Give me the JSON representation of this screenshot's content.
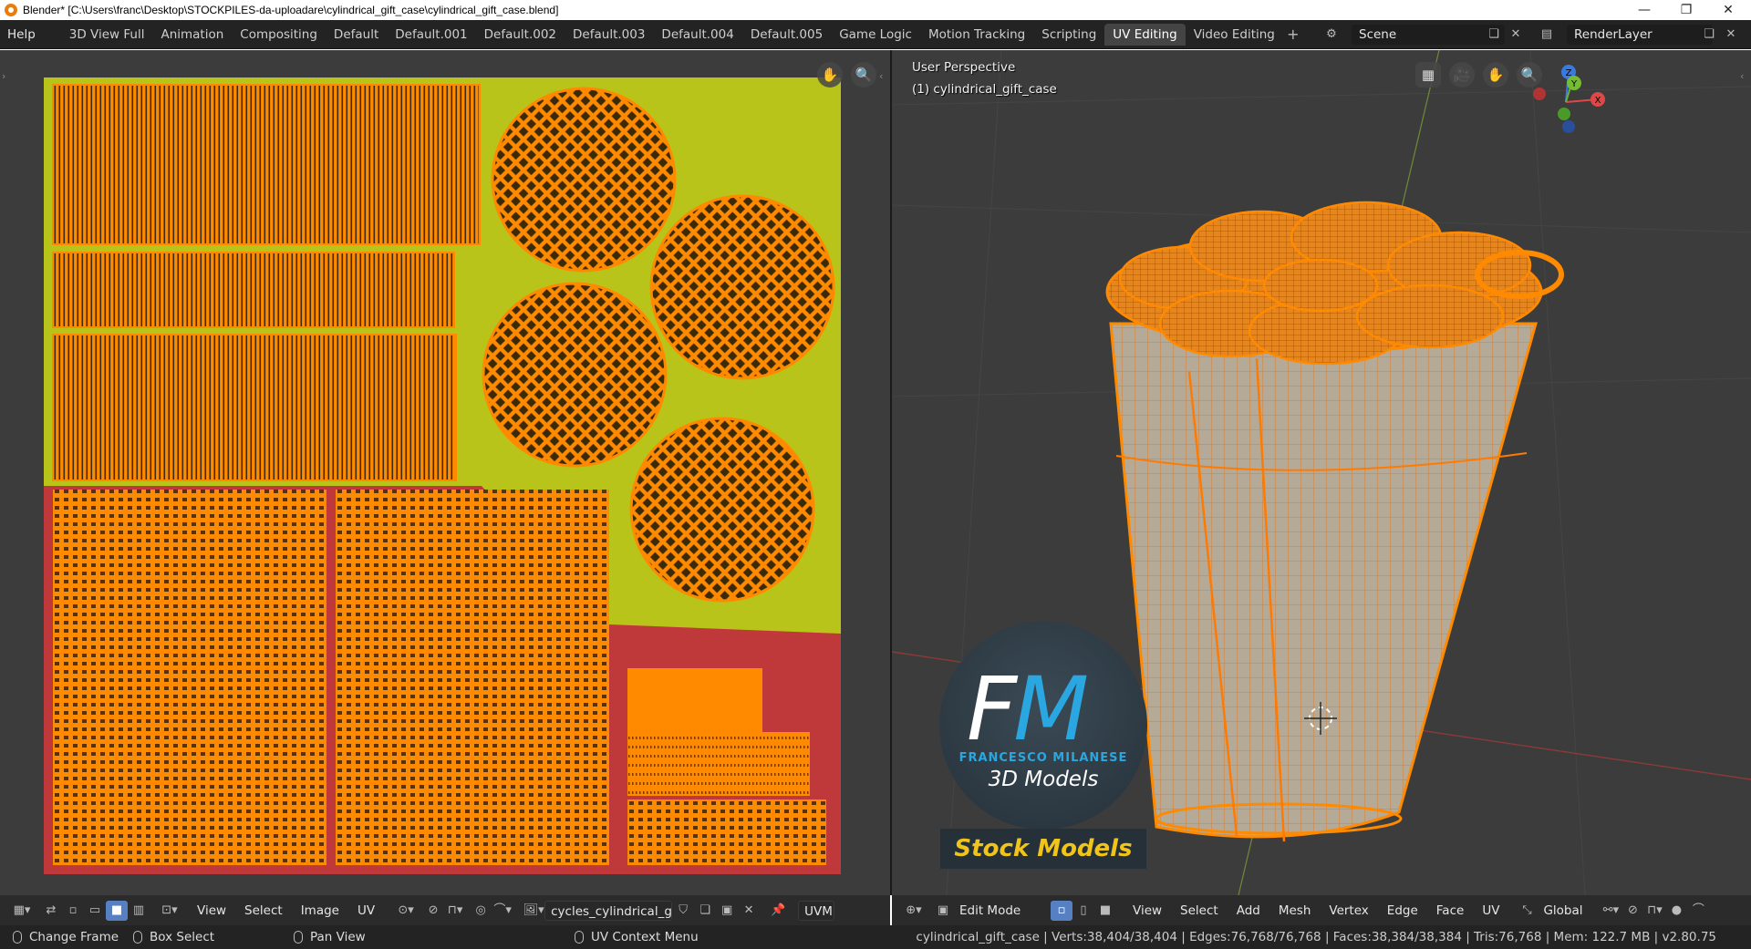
{
  "window": {
    "title": "Blender* [C:\\Users\\franc\\Desktop\\STOCKPILES-da-uploadare\\cylindrical_gift_case\\cylindrical_gift_case.blend]",
    "minimize": "—",
    "restore": "❐",
    "close": "✕"
  },
  "topbar": {
    "help": "Help",
    "tabs": [
      "3D View Full",
      "Animation",
      "Compositing",
      "Default",
      "Default.001",
      "Default.002",
      "Default.003",
      "Default.004",
      "Default.005",
      "Game Logic",
      "Motion Tracking",
      "Scripting",
      "UV Editing",
      "Video Editing"
    ],
    "active_tab": "UV Editing",
    "add_tab": "+",
    "scene_value": "Scene",
    "render_layer_value": "RenderLayer"
  },
  "uv_editor": {
    "header_menus": [
      "View",
      "Select",
      "Image",
      "UV"
    ],
    "image_name": "cycles_cylindrical_g...",
    "uv_map_label": "UVM"
  },
  "viewport": {
    "perspective_label": "User Perspective",
    "object_label": "(1) cylindrical_gift_case",
    "mode": "Edit Mode",
    "header_menus": [
      "View",
      "Select",
      "Add",
      "Mesh",
      "Vertex",
      "Edge",
      "Face",
      "UV"
    ],
    "orientation": "Global",
    "gizmo_axes": {
      "x": "X",
      "y": "Y",
      "z": "Z"
    }
  },
  "watermark": {
    "f": "F",
    "m": "M",
    "name": "FRANCESCO MILANESE",
    "sub": "3D Models",
    "stock": "Stock Models"
  },
  "statusbar": {
    "hint1": "Change Frame",
    "hint2": "Box Select",
    "hint3": "Pan View",
    "hint4": "UV Context Menu",
    "stats": "cylindrical_gift_case | Verts:38,404/38,404 | Edges:76,768/76,768 | Faces:38,384/38,384 | Tris:76,768 | Mem: 122.7 MB | v2.80.75"
  },
  "colors": {
    "uv_select": "#ff8a00",
    "uv_bg_yellow": "#b8c419",
    "uv_bg_red": "#c0393a",
    "mesh_body": "#b5aa98",
    "header_bg": "#2b2b2b",
    "active_tab_bg": "#444444",
    "accent_blue": "#5680c2"
  }
}
